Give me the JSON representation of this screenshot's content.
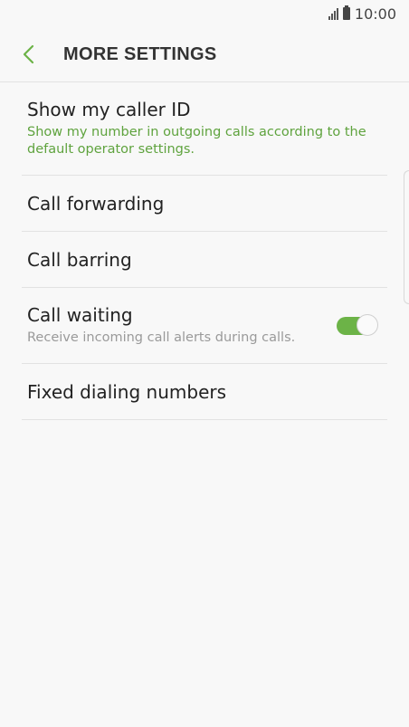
{
  "status_bar": {
    "time": "10:00",
    "signal_icon": "signal-icon",
    "battery_icon": "battery-icon"
  },
  "header": {
    "title": "MORE SETTINGS",
    "back_icon": "chevron-left-icon",
    "accent_color": "#6cb347"
  },
  "settings": {
    "items": [
      {
        "title": "Show my caller ID",
        "subtitle": "Show my number in outgoing calls according to the default operator settings."
      },
      {
        "title": "Call forwarding"
      },
      {
        "title": "Call barring"
      },
      {
        "title": "Call waiting",
        "subtitle": "Receive incoming call alerts during calls.",
        "toggle_on": true,
        "toggle_color": "#6cb347"
      },
      {
        "title": "Fixed dialing numbers"
      }
    ]
  }
}
